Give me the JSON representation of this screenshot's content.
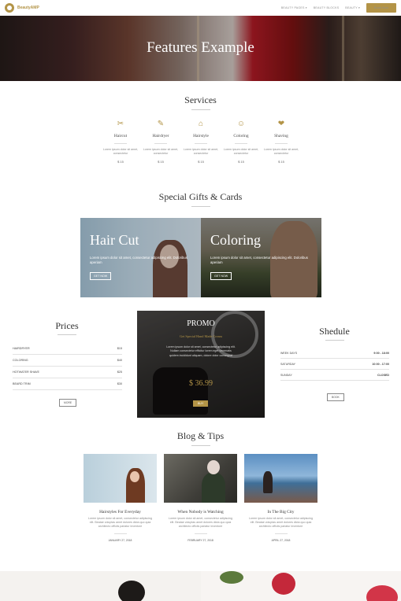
{
  "header": {
    "brand": "BeautyAMP",
    "nav": [
      "BEAUTY PAGES ▾",
      "BEAUTY BLOCKS",
      "BEAUTY ▾"
    ],
    "cta": "Book Now"
  },
  "hero": {
    "title": "Features Example"
  },
  "services": {
    "title": "Services",
    "items": [
      {
        "name": "Haircut",
        "icon": "scissors-icon",
        "glyph": "✂",
        "desc": "Lorem ipsum dolor sit amet, consectetur",
        "price": "$ 15"
      },
      {
        "name": "Hairdryer",
        "icon": "brush-icon",
        "glyph": "✎",
        "desc": "Lorem ipsum dolor sit amet, consectetur",
        "price": "$ 15"
      },
      {
        "name": "Hairstyle",
        "icon": "bag-icon",
        "glyph": "⌂",
        "desc": "Lorem ipsum dolor sit amet, consectetur",
        "price": "$ 15"
      },
      {
        "name": "Coloring",
        "icon": "smile-icon",
        "glyph": "☺",
        "desc": "Lorem ipsum dolor sit amet, consectetur",
        "price": "$ 15"
      },
      {
        "name": "Shaving",
        "icon": "heart-icon",
        "glyph": "❤",
        "desc": "Lorem ipsum dolor sit amet, consectetur",
        "price": "$ 15"
      }
    ]
  },
  "gifts": {
    "title": "Special Gifts & Cards",
    "cards": [
      {
        "title": "Hair Cut",
        "text": "Lorem ipsum dolor sit amet, consectetur adipiscing elit. Doloribus aperiam",
        "button": "GET NOW"
      },
      {
        "title": "Coloring",
        "text": "Lorem ipsum dolor sit amet, consectetur adipiscing elit. Doloribus aperiam",
        "button": "GET NOW"
      }
    ]
  },
  "prices": {
    "title": "Prices",
    "rows": [
      {
        "name": "HAIRDRYER",
        "price": "$15"
      },
      {
        "name": "COLORING",
        "price": "$40"
      },
      {
        "name": "HOTWATER SHAVE",
        "price": "$25"
      },
      {
        "name": "BEARD TRIM",
        "price": "$30"
      }
    ],
    "button": "MORE"
  },
  "promo": {
    "title": "PROMO",
    "subtitle": "Get Special Hand Made Cream",
    "text": "Lorem ipsum dolor sit amet, consectetur adipiscing elit. Nullam consectetur efficitur lorem eget venenatis quidem incididunt aliquam, dolore dolor consequat",
    "price": "$ 36.99",
    "button": "BUY"
  },
  "schedule": {
    "title": "Shedule",
    "rows": [
      {
        "day": "WEEK DAYS",
        "hours": "9:00 - 18:00"
      },
      {
        "day": "SATURDAY",
        "hours": "10:00 - 17:00"
      },
      {
        "day": "SUNDAY",
        "hours": "CLOSED"
      }
    ],
    "button": "BOOK"
  },
  "blog": {
    "title": "Blog & Tips",
    "posts": [
      {
        "title": "Hairstyles For Everyday",
        "excerpt": "Lorem ipsum dolor sit amet, consectetur adipiscing elit. Beatae voluptas amet dolores dicta quo quia architecto officiis pariatur inventore",
        "date": "JANUARY 27, 2018"
      },
      {
        "title": "When Nobody is Watching",
        "excerpt": "Lorem ipsum dolor sit amet, consectetur adipiscing elit. Beatae voluptas amet dolores dicta quo quia architecto officiis pariatur inventore",
        "date": "FEBRUARY 27, 2018"
      },
      {
        "title": "In The Big City",
        "excerpt": "Lorem ipsum dolor sit amet, consectetur adipiscing elit. Beatae voluptas amet dolores dicta quo quia architecto officiis pariatur inventore",
        "date": "APRIL 27, 2018"
      }
    ]
  },
  "colors": {
    "accent": "#b39447",
    "text": "#333333"
  }
}
